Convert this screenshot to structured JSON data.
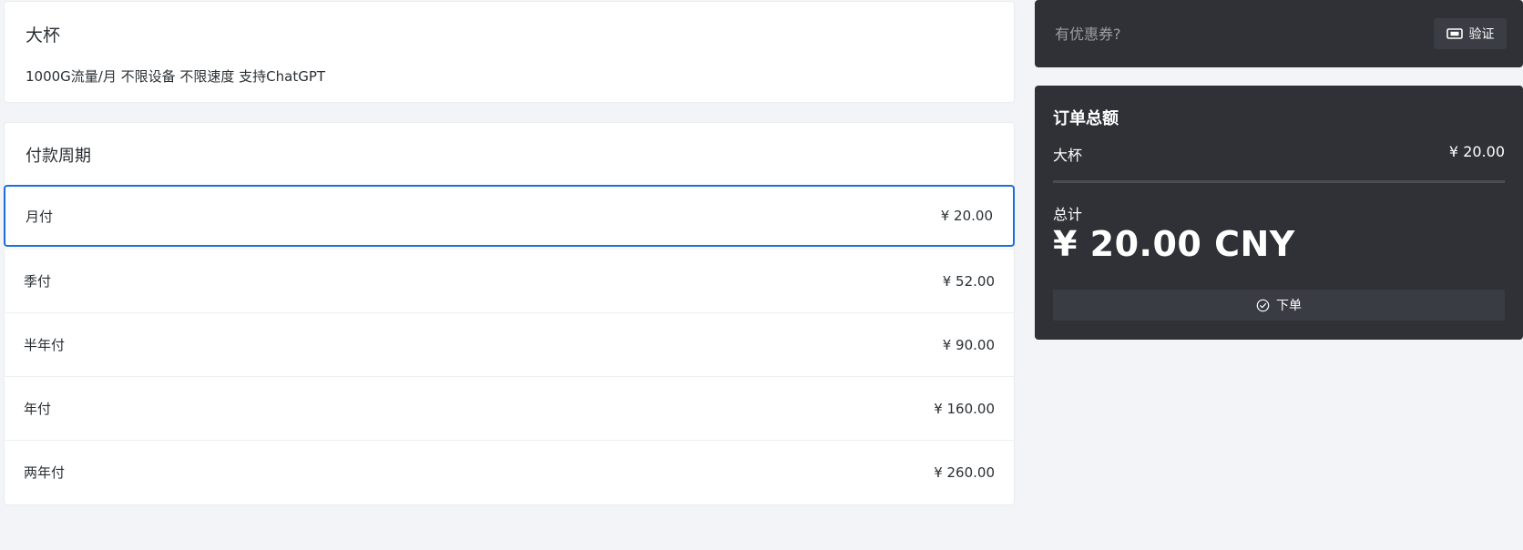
{
  "plan": {
    "title": "大杯",
    "description": "1000G流量/月 不限设备 不限速度 支持ChatGPT"
  },
  "period": {
    "title": "付款周期",
    "options": [
      {
        "label": "月付",
        "price": "¥ 20.00",
        "selected": true
      },
      {
        "label": "季付",
        "price": "¥ 52.00",
        "selected": false
      },
      {
        "label": "半年付",
        "price": "¥ 90.00",
        "selected": false
      },
      {
        "label": "年付",
        "price": "¥ 160.00",
        "selected": false
      },
      {
        "label": "两年付",
        "price": "¥ 260.00",
        "selected": false
      }
    ]
  },
  "coupon": {
    "placeholder": "有优惠券?",
    "verify_label": "验证",
    "verify_icon": "ticket-icon"
  },
  "order": {
    "title": "订单总额",
    "line_name": "大杯",
    "line_price": "¥ 20.00",
    "total_label": "总计",
    "total_amount": "¥ 20.00 CNY",
    "submit_label": "下单",
    "submit_icon": "check-circle-icon"
  },
  "colors": {
    "page_bg": "#f3f4f8",
    "card_dark": "#2f3137",
    "selected_border": "#1a6fd8"
  }
}
